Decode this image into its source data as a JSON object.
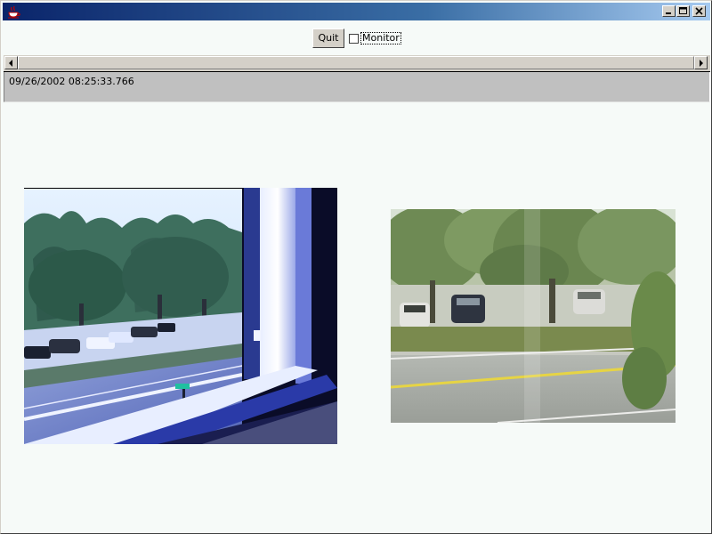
{
  "window": {
    "icon": "java-cup-icon"
  },
  "titlebar_buttons": {
    "minimize": "minimize-icon",
    "maximize": "maximize-icon",
    "close": "close-icon"
  },
  "toolbar": {
    "quit_label": "Quit",
    "monitor_label": "Monitor",
    "monitor_checked": false
  },
  "scrollbar": {
    "left_icon": "arrow-left-icon",
    "right_icon": "arrow-right-icon"
  },
  "status": {
    "timestamp": "09/26/2002 08:25:33.766"
  },
  "cameras": [
    {
      "name": "camera-view-window-parking-lot"
    },
    {
      "name": "camera-view-trees-road"
    }
  ],
  "colors": {
    "title_gradient_start": "#0a246a",
    "title_gradient_end": "#a6caf0",
    "panel_bg": "#c0c0c0",
    "content_bg": "#f6faf8"
  }
}
